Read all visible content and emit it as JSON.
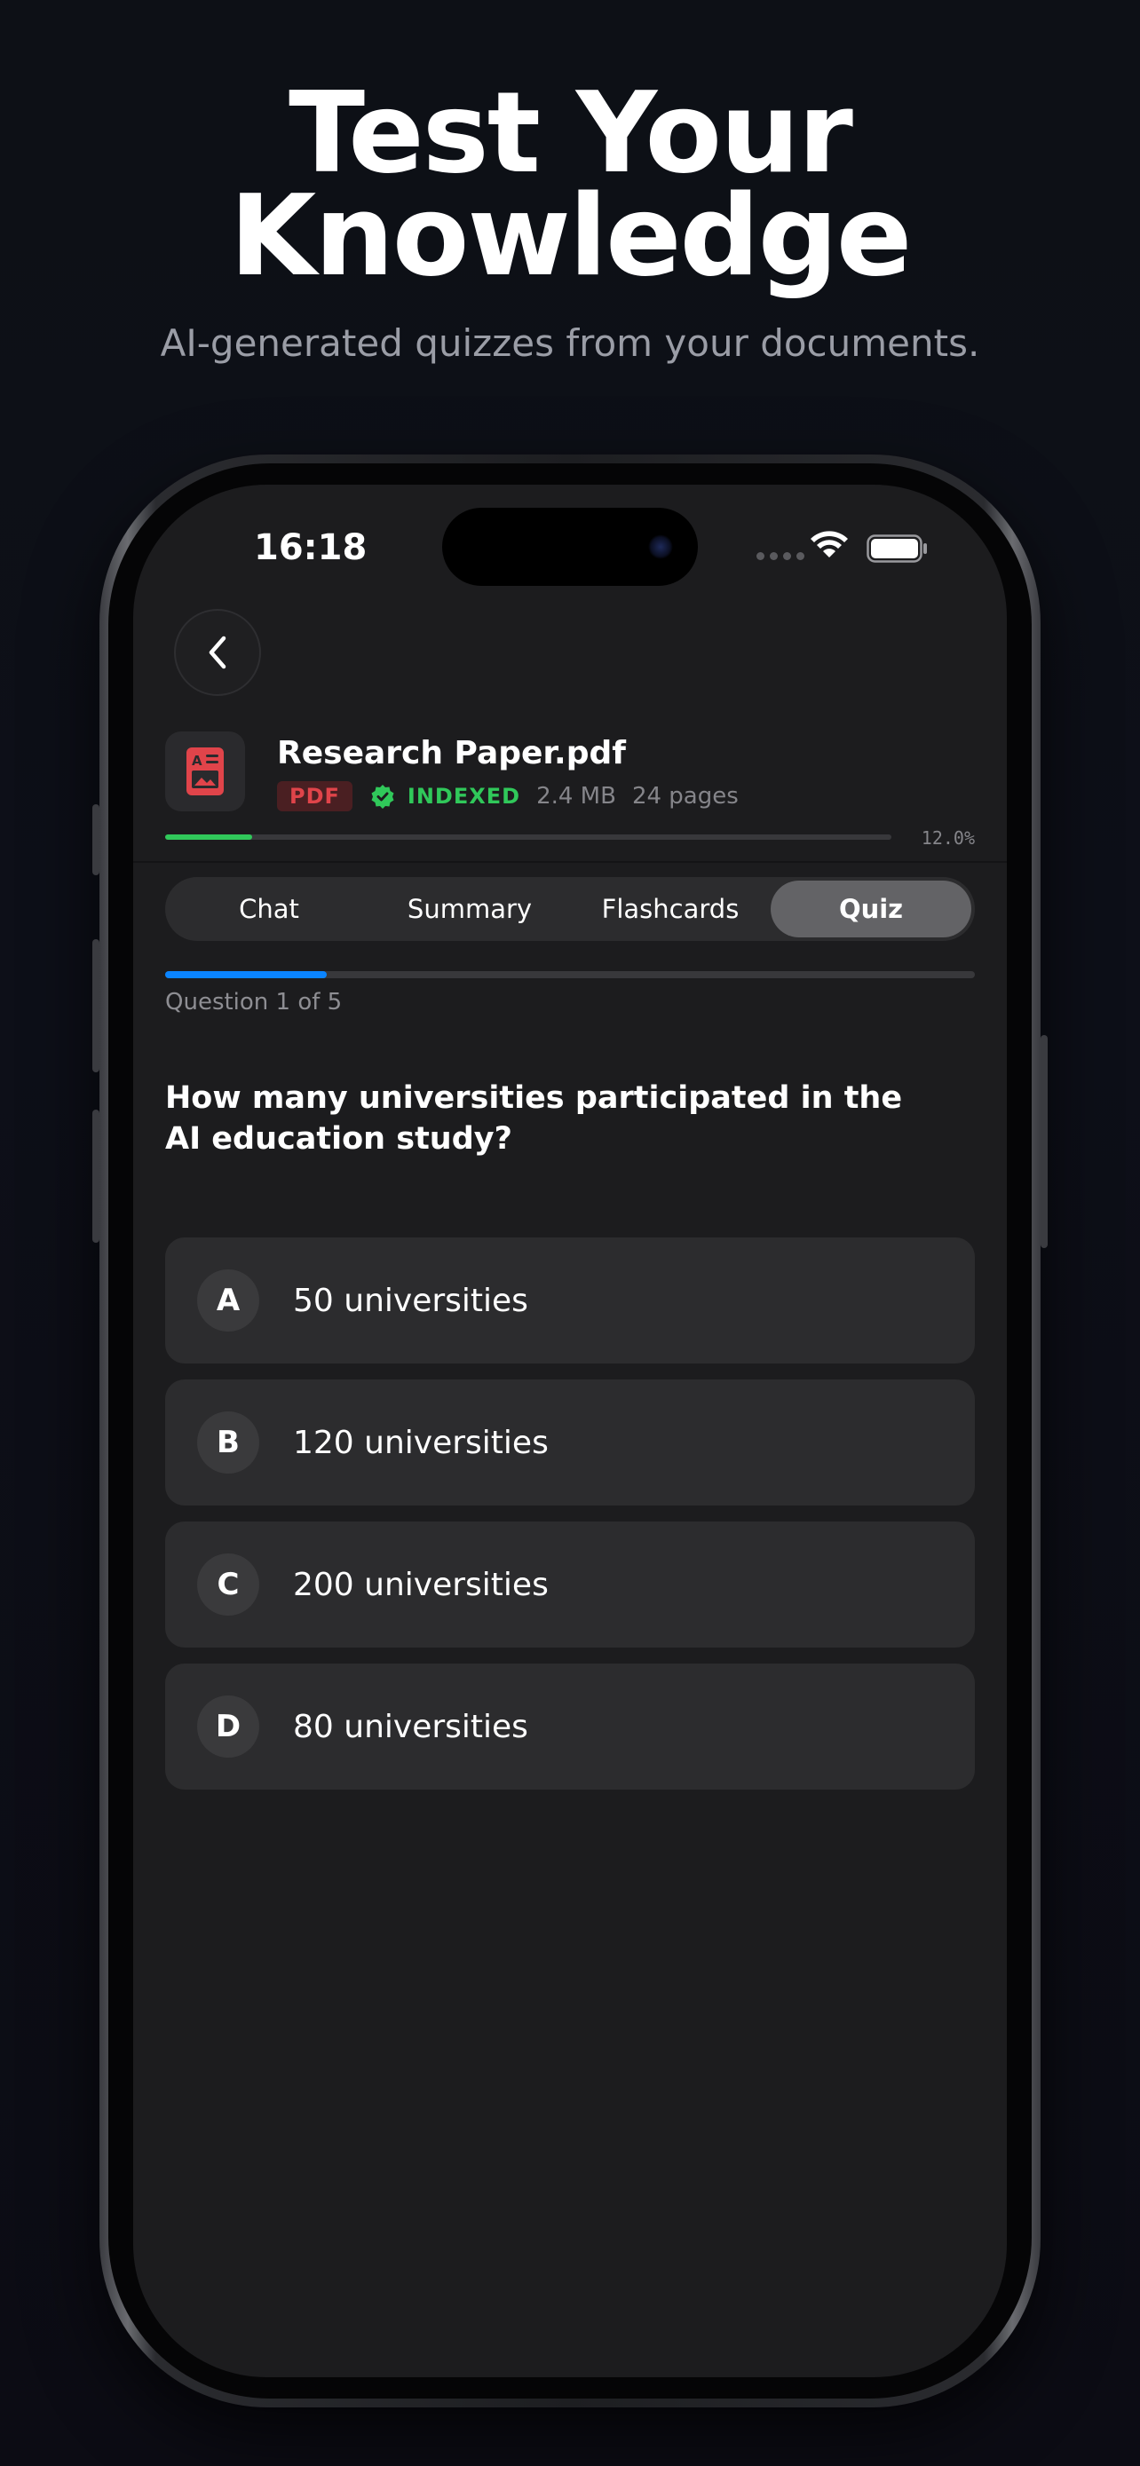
{
  "marketing": {
    "headline_line1": "Test Your",
    "headline_line2": "Knowledge",
    "subheadline": "AI-generated quizzes from your documents."
  },
  "status_bar": {
    "time": "16:18"
  },
  "document": {
    "title": "Research Paper.pdf",
    "type_badge": "PDF",
    "status": "INDEXED",
    "size": "2.4 MB",
    "pages": "24 pages",
    "read_progress_label": "12.0%",
    "read_progress": 0.12
  },
  "tabs": [
    {
      "label": "Chat",
      "active": false
    },
    {
      "label": "Summary",
      "active": false
    },
    {
      "label": "Flashcards",
      "active": false
    },
    {
      "label": "Quiz",
      "active": true
    }
  ],
  "quiz": {
    "progress_label": "Question 1 of 5",
    "progress": 0.2,
    "question": "How many universities participated in the AI education study?",
    "options": [
      {
        "letter": "A",
        "text": "50 universities"
      },
      {
        "letter": "B",
        "text": "120 universities"
      },
      {
        "letter": "C",
        "text": "200 universities"
      },
      {
        "letter": "D",
        "text": "80 universities"
      }
    ]
  },
  "colors": {
    "accent_blue": "#0a84ff",
    "success_green": "#30c85a",
    "pdf_red": "#e0444a"
  },
  "icons": {
    "back": "chevron-left-icon",
    "document": "pdf-file-icon",
    "indexed": "check-badge-icon",
    "wifi": "wifi-icon",
    "battery": "battery-icon"
  }
}
